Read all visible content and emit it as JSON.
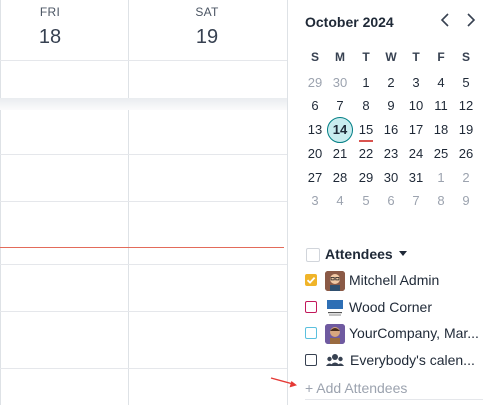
{
  "week": {
    "days": [
      {
        "name": "FRI",
        "number": "18"
      },
      {
        "name": "SAT",
        "number": "19"
      }
    ]
  },
  "mini_calendar": {
    "title": "October 2024",
    "prev_icon": "chevron-left-icon",
    "next_icon": "chevron-right-icon",
    "weekdays": [
      "S",
      "M",
      "T",
      "W",
      "T",
      "F",
      "S"
    ],
    "weeks": [
      [
        "29",
        "30",
        "1",
        "2",
        "3",
        "4",
        "5"
      ],
      [
        "6",
        "7",
        "8",
        "9",
        "10",
        "11",
        "12"
      ],
      [
        "13",
        "14",
        "15",
        "16",
        "17",
        "18",
        "19"
      ],
      [
        "20",
        "21",
        "22",
        "23",
        "24",
        "25",
        "26"
      ],
      [
        "27",
        "28",
        "29",
        "30",
        "31",
        "1",
        "2"
      ],
      [
        "3",
        "4",
        "5",
        "6",
        "7",
        "8",
        "9"
      ]
    ],
    "selected_day": "14",
    "today_day": "15",
    "accent": "#017e84",
    "selected_bg": "#c9ecef",
    "today_marker_color": "#d9534f"
  },
  "attendees": {
    "header": "Attendees",
    "items": [
      {
        "label": "Mitchell Admin",
        "checked": true,
        "color": "#f0b429",
        "avatar": "person-avatar-icon"
      },
      {
        "label": "Wood Corner",
        "checked": false,
        "color": "#c2185b",
        "avatar": "company-logo-icon"
      },
      {
        "label": "YourCompany, Mar...",
        "checked": false,
        "color": "#5bc0de",
        "avatar": "person-avatar-icon"
      },
      {
        "label": "Everybody's calen...",
        "checked": false,
        "color": "#374151",
        "avatar": "users-group-icon"
      }
    ],
    "add_label": "+ Add Attendees"
  },
  "now_line_color": "#e36b5a"
}
